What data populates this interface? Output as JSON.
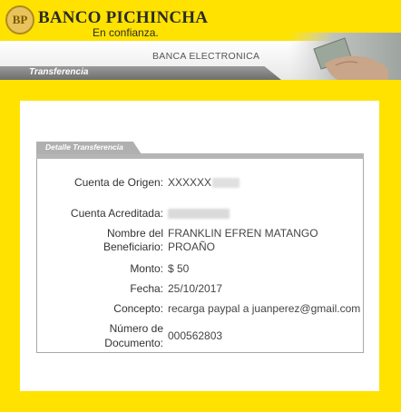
{
  "header": {
    "logo_text": "BP",
    "bank_name": "BANCO PICHINCHA",
    "slogan": "En confianza.",
    "banner_title": "BANCA ELECTRONICA",
    "tab_label": "Transferencia"
  },
  "detail": {
    "section_title": "Detalle Transferencia",
    "rows": [
      {
        "label": "Cuenta de Origen:",
        "value": "XXXXXX"
      },
      {
        "label": "Cuenta Acreditada:",
        "value": ""
      },
      {
        "label_line1": "Nombre del",
        "label_line2": "Beneficiario:",
        "value_line1": "FRANKLIN EFREN MATANGO",
        "value_line2": "PROAÑO"
      },
      {
        "label": "Monto:",
        "value": "$ 50"
      },
      {
        "label": "Fecha:",
        "value": "25/10/2017"
      },
      {
        "label": "Concepto:",
        "value": "recarga paypal a juanperez@gmail.com"
      },
      {
        "label_line1": "Número de",
        "label_line2": "Documento:",
        "value": "000562803"
      }
    ]
  },
  "colors": {
    "brand_yellow": "#FFE200",
    "tab_gray": "#7F7F7F",
    "text_dark": "#333333"
  }
}
